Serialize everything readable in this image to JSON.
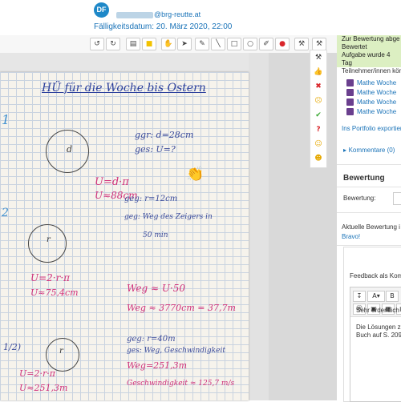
{
  "header": {
    "avatar_initials": "DF",
    "email_suffix": "@brg-reutte.at",
    "due_date": "Fälligkeitsdatum: 20. März 2020, 22:00"
  },
  "toolbar": {
    "icons": [
      "undo-icon",
      "redo-icon",
      "comment-icon",
      "highlight-icon",
      "pan-icon",
      "select-icon",
      "pen-icon",
      "line-icon",
      "rectangle-icon",
      "oval-icon",
      "brush-icon",
      "color-icon",
      "stamp-icon",
      "stamp-small-icon"
    ],
    "glyphs": [
      "↺",
      "↻",
      "▤",
      "■",
      "✋",
      "➤",
      "✎",
      "╲",
      "□",
      "○",
      "✐",
      "●",
      "⚒",
      "⚒"
    ]
  },
  "palette": {
    "icons": [
      "stamp-icon",
      "thumbs-up-icon",
      "cross-icon",
      "smiley-sad-icon",
      "check-icon",
      "question-icon",
      "smiley-icon",
      "smiley-happy-icon"
    ],
    "glyphs": [
      "⚒",
      "👍",
      "✖",
      "☹",
      "✔",
      "?",
      "☺",
      "☻"
    ],
    "colors": [
      "#777",
      "#e6a800",
      "#d9262b",
      "#e6a800",
      "#3aa832",
      "#d9262b",
      "#e6a800",
      "#e6a800"
    ]
  },
  "document": {
    "title": "HÜ für die Woche bis Ostern",
    "section1_num": "1",
    "given1": "ggr: d=28cm",
    "sought1": "ges: U=?",
    "circle1_label": "d",
    "formula1": "U=d·π",
    "result1": "U≈88cm",
    "section2_num": "2",
    "circle2_label": "r",
    "given2": "geg: r=12cm",
    "given2b": "geg: Weg des Zeigers in",
    "given2c": "50 min",
    "formula2": "U=2·r·π",
    "result2": "U≈75,4cm",
    "way1": "Weg ≈ U·50",
    "way2": "Weg ≈ 3770cm = 37,7m",
    "section3_num": "1/2)",
    "circle3_label": "r",
    "given3": "geg: r=40m",
    "given3b": "ges: Weg, Geschwindigkeit",
    "formula3": "U=2·r·π",
    "result3": "U≈251,3m",
    "way3": "Weg=251,3m",
    "speed3": "Geschwindigkeit ≈ 125,7 m/s"
  },
  "rightpanel": {
    "status_line1": "Zur Bewertung abge",
    "status_line2": "Bewertet",
    "status_line3": "Aufgabe wurde 4 Tag",
    "status_line4": "Teilnehmer/innen kön",
    "files": [
      "Mathe Woche",
      "Mathe Woche",
      "Mathe Woche",
      "Mathe Woche"
    ],
    "portfolio_link": "Ins Portfolio exportier",
    "comments_link": "Kommentare (0)",
    "grading_heading": "Bewertung",
    "grading_label": "Bewertung:",
    "current_grade_label": "Aktuelle Bewertung i",
    "current_grade_value": "Bravo!",
    "feedback_label": "Feedback als Kom",
    "editor_text1": "Sehr ordentlich",
    "editor_text2": "Die Lösungen zu",
    "editor_text3": "Buch auf S. 209"
  }
}
